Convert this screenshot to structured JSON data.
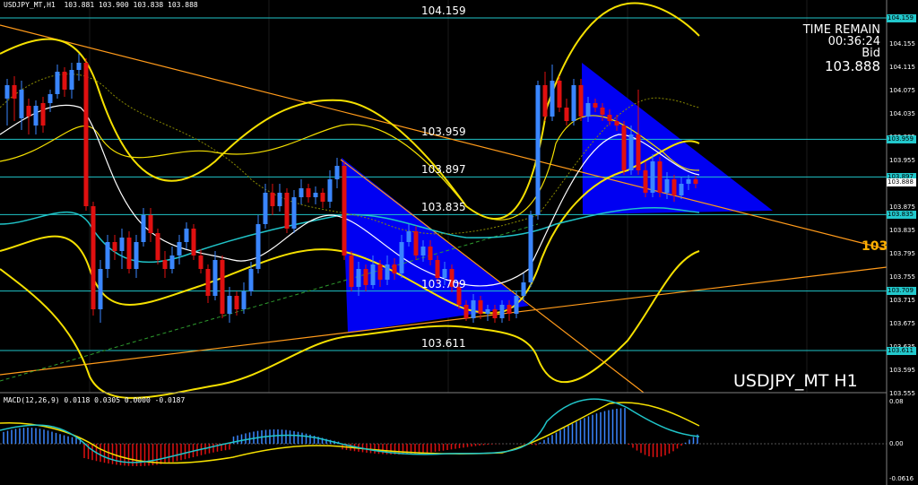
{
  "header": {
    "title": "USDJPY_MT,H1",
    "ohlc": "103.881 103.900 103.838 103.888"
  },
  "info_panel": {
    "label": "TIME REMAIN",
    "time": "00:36:24",
    "bid_label": "Bid",
    "bid_value": "103.888"
  },
  "symbol_label": "USDJPY_MT H1",
  "levels": [
    {
      "price": 104.159,
      "label": "104.159",
      "axis_tag": "104.159"
    },
    {
      "price": 103.959,
      "label": "103.959",
      "axis_tag": "103.959"
    },
    {
      "price": 103.897,
      "label": "103.897",
      "axis_tag": "103.897"
    },
    {
      "price": 103.835,
      "label": "103.835",
      "axis_tag": "103.835"
    },
    {
      "price": 103.709,
      "label": "103.709",
      "axis_tag": "103.709"
    },
    {
      "price": 103.611,
      "label": "103.611",
      "axis_tag": "103.611"
    }
  ],
  "bid_tag": "103.888",
  "price_axis_ticks": [
    "104.155",
    "104.115",
    "104.075",
    "104.035",
    "103.995",
    "103.955",
    "103.915",
    "103.875",
    "103.835",
    "103.795",
    "103.755",
    "103.715",
    "103.675",
    "103.635",
    "103.595",
    "103.555"
  ],
  "trendline_label": "103",
  "macd": {
    "header": "MACD(12,26,9) 0.0118 0.0305 0.0000 -0.0187",
    "ticks": [
      "0.08",
      "0.00",
      "-0.0616"
    ]
  },
  "colors": {
    "background": "#000000",
    "bull_candle": "#3a86ff",
    "bear_candle": "#e01010",
    "level_line": "#20c4c8",
    "bollinger": "#f5e000",
    "ma_fast": "#ffffff",
    "ma_slow": "#20c4c8",
    "trendline": "#ff9a1a",
    "triangle_fill": "#0000ff",
    "macd_signal": "#f5e000",
    "macd_main": "#20c4c8"
  }
}
